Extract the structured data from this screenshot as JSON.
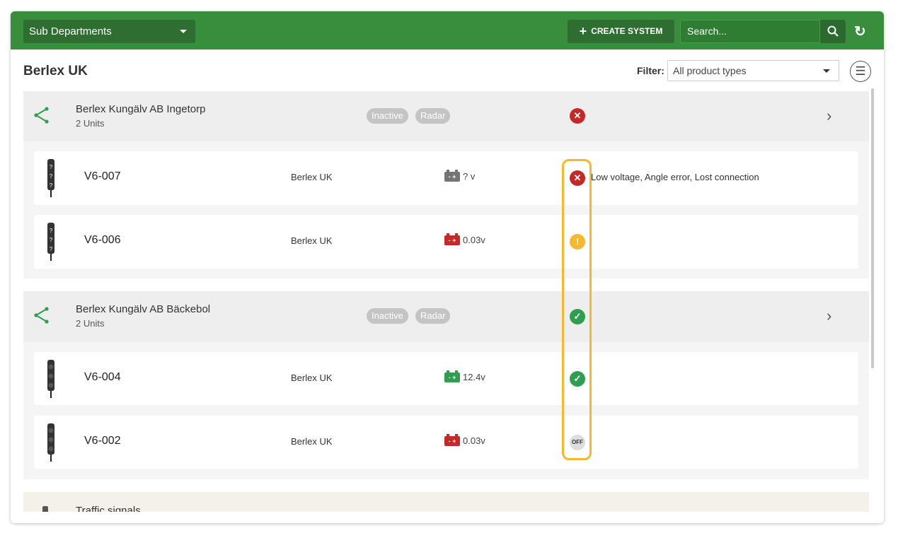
{
  "header": {
    "department_select": "Sub Departments",
    "create_label": "CREATE SYSTEM",
    "search_placeholder": "Search..."
  },
  "page": {
    "title": "Berlex UK",
    "filter_label": "Filter:",
    "filter_value": "All product types"
  },
  "groups": [
    {
      "name": "Berlex Kungälv AB Ingetorp",
      "units": "2 Units",
      "tags": [
        "Inactive",
        "Radar"
      ],
      "status": "error",
      "items": [
        {
          "name": "V6-007",
          "location": "Berlex UK",
          "battery": "? v",
          "battery_color": "#757575",
          "status": "error",
          "message": "Low voltage, Angle error, Lost connection"
        },
        {
          "name": "V6-006",
          "location": "Berlex UK",
          "battery": "0.03v",
          "battery_color": "#c62828",
          "status": "warning",
          "message": ""
        }
      ]
    },
    {
      "name": "Berlex Kungälv AB Bäckebol",
      "units": "2 Units",
      "tags": [
        "Inactive",
        "Radar"
      ],
      "status": "ok",
      "items": [
        {
          "name": "V6-004",
          "location": "Berlex UK",
          "battery": "12.4v",
          "battery_color": "#2e9e4f",
          "status": "ok",
          "message": ""
        },
        {
          "name": "V6-002",
          "location": "Berlex UK",
          "battery": "0.03v",
          "battery_color": "#c62828",
          "status": "off",
          "message": "",
          "off_label": "OFF"
        }
      ]
    },
    {
      "name": "Traffic signals"
    }
  ],
  "colors": {
    "header": "#388e3c",
    "error": "#c62828",
    "warning": "#f5b82e",
    "ok": "#2e9e4f",
    "highlight": "#f5b82e"
  }
}
